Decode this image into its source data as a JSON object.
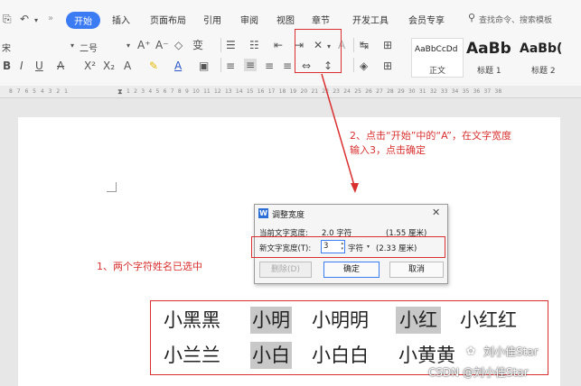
{
  "toolbar": {
    "tabs": [
      "开始",
      "插入",
      "页面布局",
      "引用",
      "审阅",
      "视图",
      "章节",
      "开发工具",
      "会员专享"
    ],
    "search_placeholder": "查找命令、搜索模板",
    "font_name": "宋",
    "font_size": "二号",
    "styles": [
      {
        "preview": "AaBbCcDd",
        "name": "正文"
      },
      {
        "preview": "AaBb",
        "name": "标题 1"
      },
      {
        "preview": "AaBb(",
        "name": "标题 2"
      }
    ]
  },
  "ruler": {
    "left_ticks": "8 7 6 5 4 3 2 1",
    "right_ticks": "1 2 3 4 5 6 7 8 9 10 11 12 13 14 15 16 17 18 19 20 21 22 23 24 25 26 27 28 29 30 31 32 33 34 35 36 37 38"
  },
  "annotations": {
    "step1": "1、两个字符姓名已选中",
    "step2_line1": "2、点击“开始”中的“A”，在文字宽度",
    "step2_line2": "输入3，点击确定"
  },
  "colors": {
    "accent": "#3b7bf3",
    "annotation_red": "#d9302f",
    "selection_gray": "#c8c8c8"
  },
  "dialog": {
    "title": "调整宽度",
    "current_label": "当前文字宽度:",
    "current_value": "2.0 字符",
    "current_cm": "(1.55 厘米)",
    "new_label": "新文字宽度(T):",
    "new_value": "3",
    "new_unit": "字符",
    "new_cm": "(2.33 厘米)",
    "delete_button": "删除(D)",
    "ok_button": "确定",
    "cancel_button": "取消"
  },
  "names": {
    "row1": [
      "小黑黑",
      "小明",
      "小明明",
      "小红",
      "小红红"
    ],
    "row2": [
      "小兰兰",
      "小白",
      "小白白",
      "小黄黄"
    ]
  },
  "watermark": {
    "account": "刘小佳Star",
    "credit": "CSDN @刘小佳Star"
  }
}
